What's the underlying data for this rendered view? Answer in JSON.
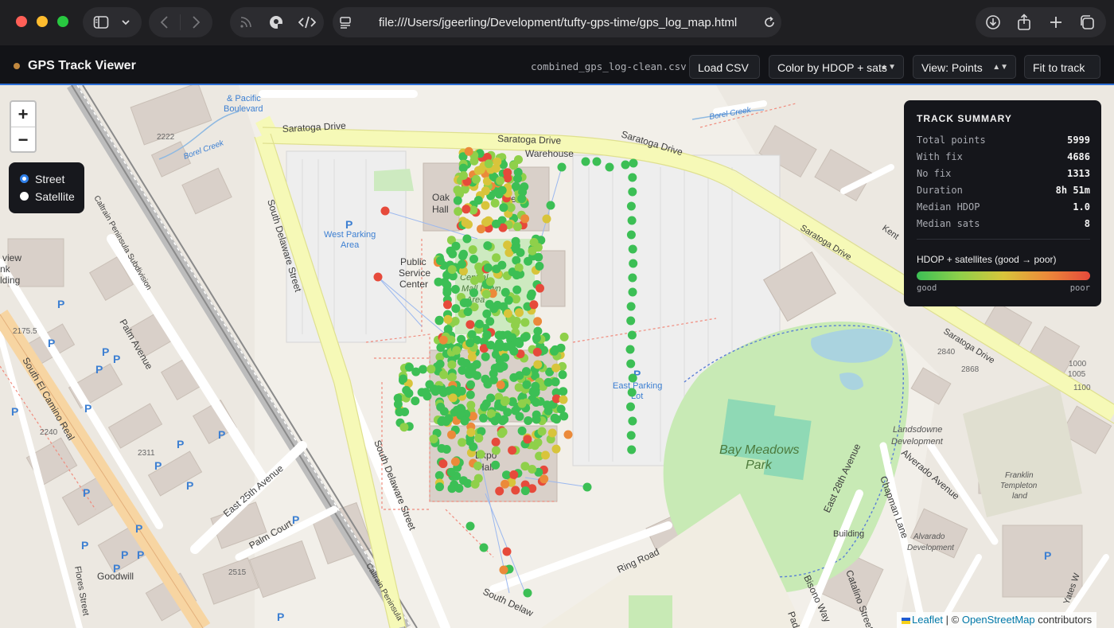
{
  "browser": {
    "url": "file:///Users/jgeerling/Development/tufty-gps-time/gps_log_map.html",
    "icons": [
      "sidebar-icon",
      "chevron-down-icon",
      "back-icon",
      "forward-icon",
      "rss-icon",
      "privacy-icon",
      "code-icon",
      "page-icon",
      "reload-icon",
      "download-icon",
      "share-icon",
      "new-tab-icon",
      "tabs-icon"
    ]
  },
  "app": {
    "title": "GPS Track Viewer",
    "file_name": "combined_gps_log-clean.csv",
    "load_button": "Load CSV",
    "color_select": "Color by HDOP + sats",
    "view_select": "View: Points",
    "fit_button": "Fit to track"
  },
  "map_controls": {
    "zoom_in": "+",
    "zoom_out": "−",
    "layers": [
      {
        "label": "Street",
        "selected": true
      },
      {
        "label": "Satellite",
        "selected": false
      }
    ]
  },
  "summary": {
    "title": "TRACK SUMMARY",
    "rows": [
      {
        "label": "Total points",
        "value": "5999"
      },
      {
        "label": "With fix",
        "value": "4686"
      },
      {
        "label": "No fix",
        "value": "1313"
      },
      {
        "label": "Duration",
        "value": "8h 51m"
      },
      {
        "label": "Median HDOP",
        "value": "1.0"
      },
      {
        "label": "Median sats",
        "value": "8"
      }
    ],
    "legend_title": "HDOP + satellites (good → poor)",
    "legend_good": "good",
    "legend_poor": "poor",
    "gradient_colors": [
      "#3cbf55",
      "#8fd04a",
      "#d8c43b",
      "#eb8a3a",
      "#e64a3b"
    ]
  },
  "attribution": {
    "leaflet": "Leaflet",
    "separator": " | © ",
    "osm": "OpenStreetMap",
    "suffix": " contributors"
  },
  "map_labels": {
    "saratoga_drive": "Saratoga Drive",
    "warehouse": "Warehouse",
    "oak_hall": "Oak",
    "oak_hall_2": "Hall",
    "ess": "ess",
    "west_parking": "West Parking",
    "area": "Area",
    "public": "Public",
    "service": "Service",
    "center": "Center",
    "central_mall": "Central",
    "mall_lawn": "Mall Lawn",
    "mall_area": "Area",
    "east_parking": "East Parking",
    "lot": "Lot",
    "expo": "Expo",
    "expo_hall": "Hall",
    "bay_meadows": "Bay Meadows",
    "park": "Park",
    "south_delaware": "South Delaware Street",
    "south_delaware_2": "South Delaware Street",
    "south_delaware_3": "South Delaw",
    "palm_avenue": "Palm Avenue",
    "south_el_camino": "South El Camino Real",
    "east_25th": "East 25th Avenue",
    "palm_court": "Palm Court",
    "caltrain_sub": "Caltrain Peninsula Subdivision",
    "caltrain_pen": "Caltrain Peninsula",
    "pacific_blvd": "& Pacific",
    "pacific_blvd_2": "Boulevard",
    "borel_creek": "Borel Creek",
    "borel_creek_2": "Borel Creek",
    "ring_road": "Ring Road",
    "east_28th": "East 28th Avenue",
    "chapman_lane": "Chapman Lane",
    "alverado": "Alverado Avenue",
    "landsdowne": "Landsdowne",
    "development": "Development",
    "building": "Building",
    "alvarado_dev": "Alvarado",
    "alvarado_dev_2": "Development",
    "franklin": "Franklin",
    "templeton": "Templeton",
    "land": "land",
    "kent": "Kent",
    "bisono": "Bisono Way",
    "catalino": "Catalino Street",
    "yates": "Yates W",
    "padd": "Padd",
    "goodwill": "Goodwill",
    "flores": "Flores Street",
    "view": "view",
    "nk": "nk",
    "ding": "lding",
    "n2222": "2222",
    "n2175": "2175.5",
    "n2240": "2240",
    "n2311": "2311",
    "n2515": "2515",
    "n2840": "2840",
    "n1000": "1000",
    "n2868": "2868",
    "n1005": "1005",
    "n1100": "1100",
    "p": "P"
  }
}
